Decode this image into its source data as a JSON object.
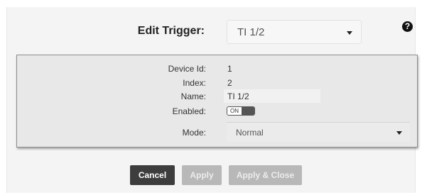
{
  "header": {
    "label": "Edit Trigger:",
    "selected_trigger": "TI 1/2",
    "help_icon": "?"
  },
  "details": {
    "device_id_label": "Device Id:",
    "device_id_value": "1",
    "index_label": "Index:",
    "index_value": "2",
    "name_label": "Name:",
    "name_value": "TI 1/2",
    "enabled_label": "Enabled:",
    "enabled_state": "ON",
    "mode_label": "Mode:",
    "mode_value": "Normal"
  },
  "buttons": {
    "cancel": "Cancel",
    "apply": "Apply",
    "apply_close": "Apply & Close"
  },
  "colors": {
    "dark_button": "#3d3d3d",
    "disabled_button": "#b8b8b8",
    "panel_background": "#e8e8e8"
  }
}
